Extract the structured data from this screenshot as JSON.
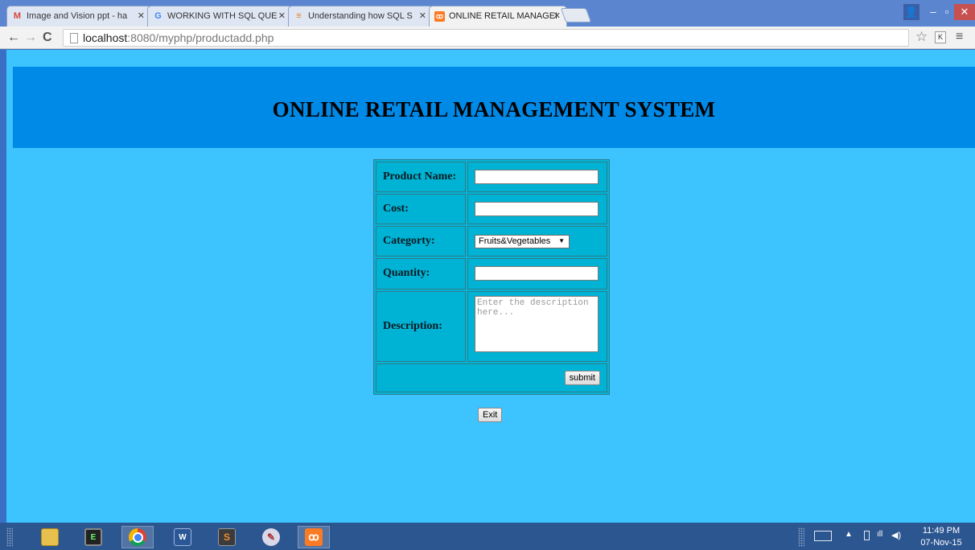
{
  "browser": {
    "tabs": [
      {
        "title": "Image and Vision ppt - ha",
        "icon": "gmail-icon",
        "active": false
      },
      {
        "title": "WORKING WITH SQL QUE",
        "icon": "google-icon",
        "active": false
      },
      {
        "title": "Understanding how SQL S",
        "icon": "stack-icon",
        "active": false
      },
      {
        "title": "ONLINE RETAIL MANAGEI",
        "icon": "xampp-icon",
        "active": true
      }
    ],
    "url_host": "localhost",
    "url_path": ":8080/myphp/productadd.php",
    "extension_label": "K"
  },
  "page": {
    "heading": "ONLINE RETAIL MANAGEMENT SYSTEM",
    "form": {
      "product_name_label": "Product Name:",
      "product_name_value": "",
      "cost_label": "Cost:",
      "cost_value": "",
      "category_label": "Categorty:",
      "category_selected": "Fruits&Vegetables",
      "quantity_label": "Quantity:",
      "quantity_value": "",
      "description_label": "Description:",
      "description_placeholder": "Enter the description here...",
      "submit_label": "submit"
    },
    "exit_label": "Exit"
  },
  "taskbar": {
    "apps": [
      "file-explorer-icon",
      "terminal-icon",
      "chrome-icon",
      "word-icon",
      "sublime-icon",
      "paint-icon",
      "xampp-icon"
    ],
    "time": "11:49 PM",
    "date": "07-Nov-15"
  },
  "colors": {
    "page_background": "#3dc3fe",
    "banner": "#008ae8",
    "form_table": "#00b2d3"
  }
}
